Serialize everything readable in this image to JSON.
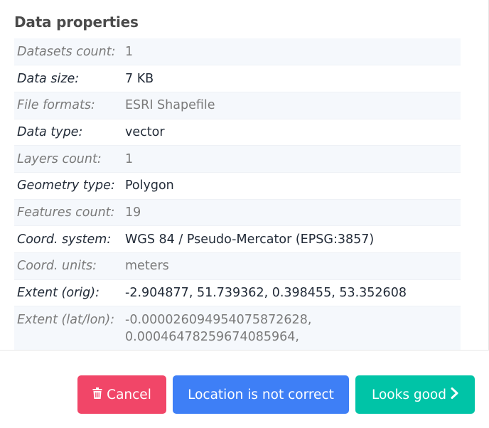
{
  "section_title": "Data properties",
  "properties": [
    {
      "key": "Datasets count:",
      "value": "1"
    },
    {
      "key": "Data size:",
      "value": "7 KB"
    },
    {
      "key": "File formats:",
      "value": "ESRI Shapefile"
    },
    {
      "key": "Data type:",
      "value": "vector"
    },
    {
      "key": "Layers count:",
      "value": "1"
    },
    {
      "key": "Geometry type:",
      "value": "Polygon"
    },
    {
      "key": "Features count:",
      "value": "19"
    },
    {
      "key": "Coord. system:",
      "value": "WGS 84 / Pseudo-Mercator (EPSG:3857)"
    },
    {
      "key": "Coord. units:",
      "value": "meters"
    },
    {
      "key": "Extent (orig):",
      "value": "-2.904877, 51.739362, 0.398455, 53.352608"
    },
    {
      "key": "Extent (lat/lon):",
      "value_line1": "-0.00002609495407587262​8,",
      "value_line2": "0.00046478259674085964,"
    }
  ],
  "buttons": {
    "cancel": {
      "label": "Cancel",
      "icon": "trash-icon"
    },
    "location": {
      "label": "Location is not correct"
    },
    "looks_good": {
      "label": "Looks good",
      "icon": "chevron-right-icon"
    }
  },
  "colors": {
    "cancel": "#f14668",
    "location": "#3e7ff6",
    "looks_good": "#00c4a7"
  }
}
